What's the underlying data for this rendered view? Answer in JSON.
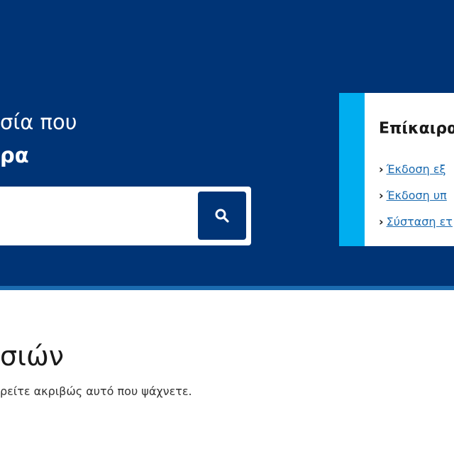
{
  "hero": {
    "line1": "σία που",
    "line2": "ρα"
  },
  "search": {
    "placeholder": "",
    "button_icon": "search-icon"
  },
  "news": {
    "title": "Επίκαιρα",
    "items": [
      {
        "label": "Έκδοση εξ"
      },
      {
        "label": "Έκδοση υπ"
      },
      {
        "label": "Σύσταση ετ"
      }
    ]
  },
  "section": {
    "heading": "σιών",
    "text": "ρείτε ακριβώς αυτό που ψάχνετε."
  },
  "colors": {
    "hero_bg": "#003476",
    "accent": "#00aeef",
    "link": "#1b6bb0"
  }
}
